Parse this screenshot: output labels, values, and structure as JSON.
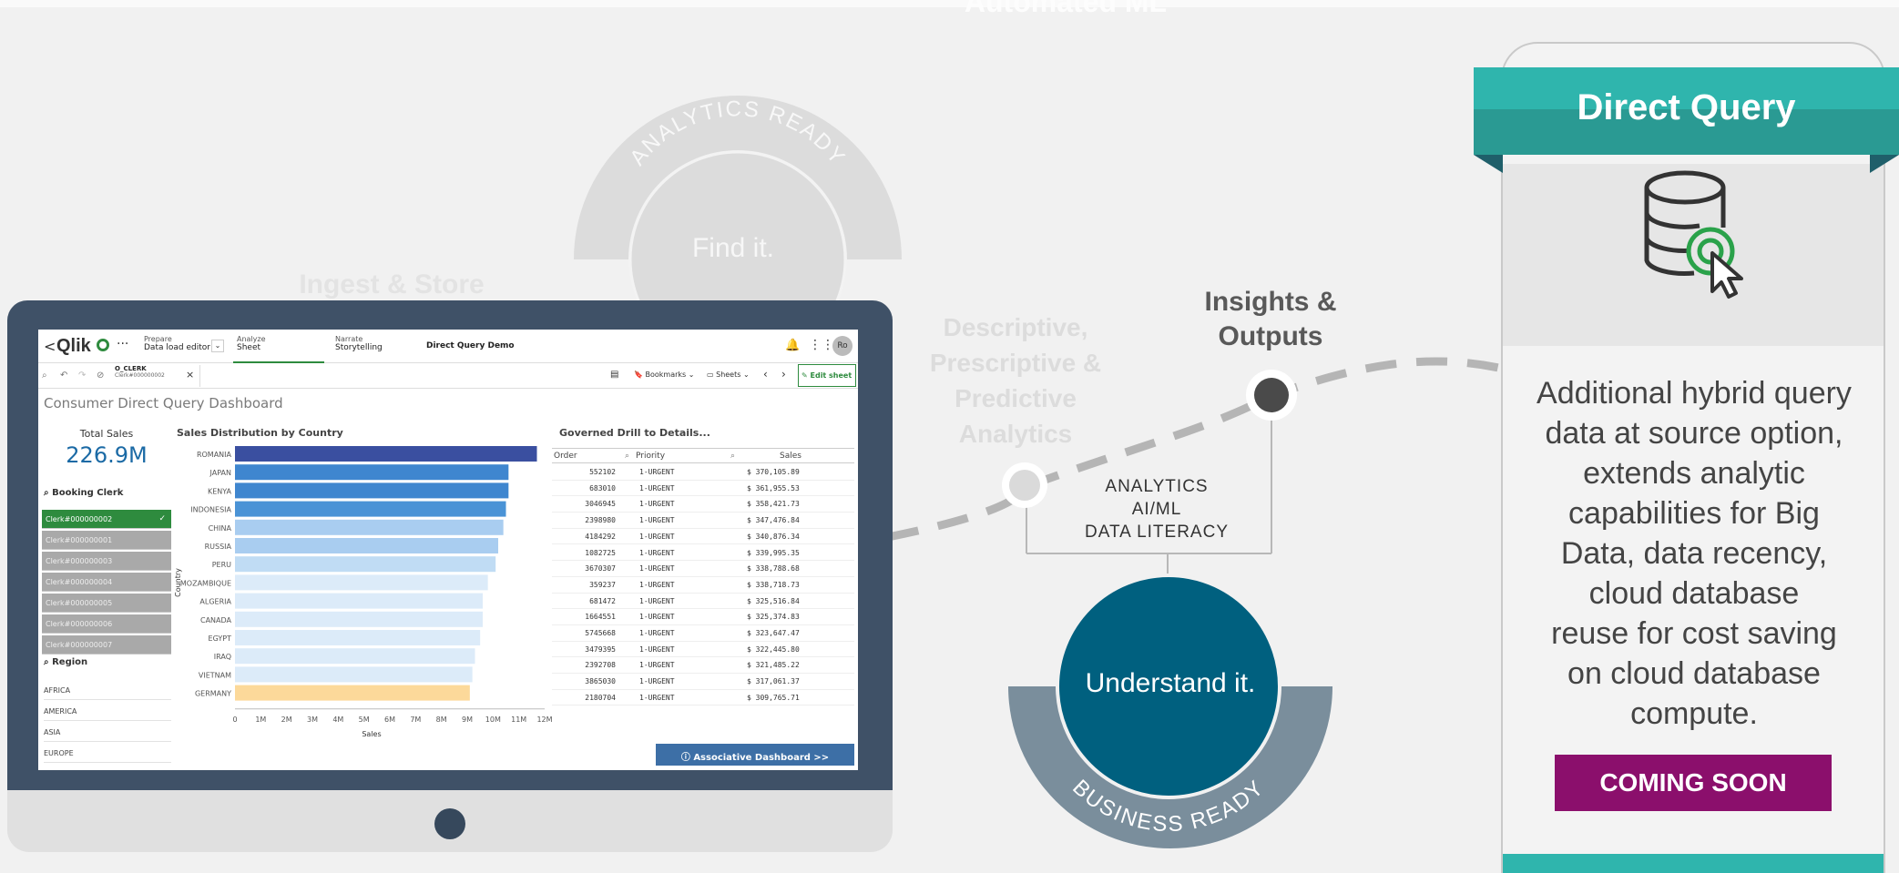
{
  "background": {
    "top_title": "Automated ML",
    "ingest_store": "Ingest & Store",
    "analytics_ready_arc": "ANALYTICS READY",
    "find_it": "Find it.",
    "descriptive": [
      "Descriptive,",
      "Prescriptive &",
      "Predictive",
      "Analytics"
    ],
    "insights": [
      "Insights &",
      "Outputs"
    ],
    "analytics_list": [
      "ANALYTICS",
      "AI/ML",
      "DATA LITERACY"
    ],
    "understand_it": "Understand it.",
    "business_ready_arc": "BUSINESS READY"
  },
  "qlik": {
    "back": "<",
    "logo": "Qlik",
    "more": "···",
    "tabs": [
      {
        "top": "Prepare",
        "bottom": "Data load editor"
      },
      {
        "top": "Analyze",
        "bottom": "Sheet"
      },
      {
        "top": "Narrate",
        "bottom": "Storytelling"
      }
    ],
    "app_name": "Direct Query Demo",
    "avatar": "Ro",
    "selection_field": "O_CLERK",
    "selection_value": "Clerk#000000002",
    "selection_close": "×",
    "bookmarks": "Bookmarks",
    "sheets": "Sheets",
    "edit_sheet": "Edit sheet",
    "dashboard_title": "Consumer Direct Query Dashboard",
    "kpi": {
      "label": "Total Sales",
      "value": "226.9M"
    },
    "booking_clerk_title": "Booking Clerk",
    "clerks": [
      "Clerk#000000002",
      "Clerk#000000001",
      "Clerk#000000003",
      "Clerk#000000004",
      "Clerk#000000005",
      "Clerk#000000006",
      "Clerk#000000007"
    ],
    "selected_check": "✓",
    "region_title": "Region",
    "regions": [
      "AFRICA",
      "AMERICA",
      "ASIA",
      "EUROPE"
    ],
    "chart_title": "Sales Distribution by Country",
    "table_title": "Governed Drill to Details...",
    "table_headers": [
      "Order",
      "Priority",
      "Sales"
    ],
    "table_rows": [
      [
        "552102",
        "1-URGENT",
        "$ 370,105.89"
      ],
      [
        "683010",
        "1-URGENT",
        "$ 361,955.53"
      ],
      [
        "3046945",
        "1-URGENT",
        "$ 358,421.73"
      ],
      [
        "2398980",
        "1-URGENT",
        "$ 347,476.84"
      ],
      [
        "4184292",
        "1-URGENT",
        "$ 340,876.34"
      ],
      [
        "1082725",
        "1-URGENT",
        "$ 339,995.35"
      ],
      [
        "3670307",
        "1-URGENT",
        "$ 338,788.68"
      ],
      [
        "359237",
        "1-URGENT",
        "$ 338,718.73"
      ],
      [
        "681472",
        "1-URGENT",
        "$ 325,516.84"
      ],
      [
        "1664551",
        "1-URGENT",
        "$ 325,374.83"
      ],
      [
        "5745668",
        "1-URGENT",
        "$ 323,647.47"
      ],
      [
        "3479395",
        "1-URGENT",
        "$ 322,445.80"
      ],
      [
        "2392708",
        "1-URGENT",
        "$ 321,485.22"
      ],
      [
        "3865030",
        "1-URGENT",
        "$ 317,061.37"
      ],
      [
        "2180704",
        "1-URGENT",
        "$ 309,765.71"
      ]
    ],
    "assoc_button": "Associative Dashboard >>"
  },
  "chart_data": {
    "type": "bar",
    "orientation": "horizontal",
    "title": "Sales Distribution by Country",
    "xlabel": "Sales",
    "ylabel": "Country",
    "categories": [
      "ROMANIA",
      "JAPAN",
      "KENYA",
      "INDONESIA",
      "CHINA",
      "RUSSIA",
      "PERU",
      "MOZAMBIQUE",
      "ALGERIA",
      "CANADA",
      "EGYPT",
      "IRAQ",
      "VIETNAM",
      "GERMANY"
    ],
    "values": [
      11.7,
      10.6,
      10.6,
      10.5,
      10.4,
      10.2,
      10.1,
      9.8,
      9.6,
      9.6,
      9.5,
      9.3,
      9.2,
      9.1
    ],
    "value_unit": "M",
    "xlim": [
      0,
      12
    ],
    "xticks": [
      "0",
      "1M",
      "2M",
      "3M",
      "4M",
      "5M",
      "6M",
      "7M",
      "8M",
      "9M",
      "10M",
      "11M",
      "12M"
    ],
    "colors": [
      "#3a4fa0",
      "#3f86cf",
      "#3f86cf",
      "#4a93d6",
      "#a9cdf0",
      "#a9cdf0",
      "#c0dcf4",
      "#dcebf9",
      "#dcebf9",
      "#dcebf9",
      "#dcebf9",
      "#dcebf9",
      "#dcebf9",
      "#fcd99a"
    ]
  },
  "card": {
    "title": "Direct Query",
    "description": [
      "Additional hybrid query",
      "data at source option,",
      "extends analytic",
      "capabilities for Big",
      "Data, data recency,",
      "cloud database",
      "reuse for cost saving",
      "on cloud database",
      "compute."
    ],
    "button": "COMING SOON",
    "icon": "database-click-icon"
  },
  "colors": {
    "teal": "#2fb5ad",
    "dark_blue": "#00607f",
    "slate": "#7a8e9c",
    "coming_soon": "#8b0f6c"
  }
}
